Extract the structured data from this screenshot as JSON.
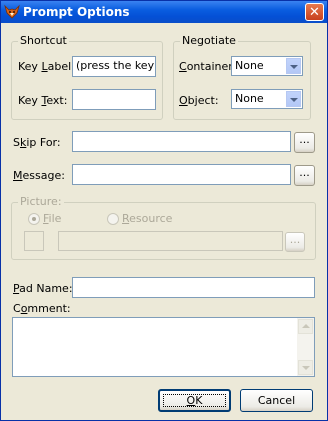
{
  "window": {
    "title": "Prompt Options"
  },
  "shortcut": {
    "group_label": "Shortcut",
    "key_label": {
      "pre": "Key ",
      "ul": "L",
      "post": "abel:",
      "value": "(press the key)"
    },
    "key_text": {
      "pre": "Key ",
      "ul": "T",
      "post": "ext:",
      "value": ""
    }
  },
  "negotiate": {
    "group_label": "Negotiate",
    "container": {
      "pre": "",
      "ul": "C",
      "post": "ontainer:",
      "value": "None"
    },
    "object": {
      "pre": "",
      "ul": "O",
      "post": "bject:",
      "value": "None"
    }
  },
  "skip_for": {
    "pre": "S",
    "ul": "k",
    "post": "ip For:",
    "value": "",
    "button": "..."
  },
  "message": {
    "pre": "",
    "ul": "M",
    "post": "essage:",
    "value": "",
    "button": "..."
  },
  "picture": {
    "group_label": "Picture:",
    "file": {
      "pre": "",
      "ul": "F",
      "post": "ile",
      "checked": true
    },
    "resource": {
      "pre": "",
      "ul": "R",
      "post": "esource",
      "checked": false
    },
    "value": "",
    "button": "..."
  },
  "pad_name": {
    "pre": "",
    "ul": "P",
    "post": "ad Name:",
    "value": ""
  },
  "comment": {
    "pre": "C",
    "ul": "o",
    "post": "mment:",
    "value": ""
  },
  "buttons": {
    "ok": {
      "pre": "",
      "ul": "O",
      "post": "K"
    },
    "cancel": "Cancel"
  }
}
